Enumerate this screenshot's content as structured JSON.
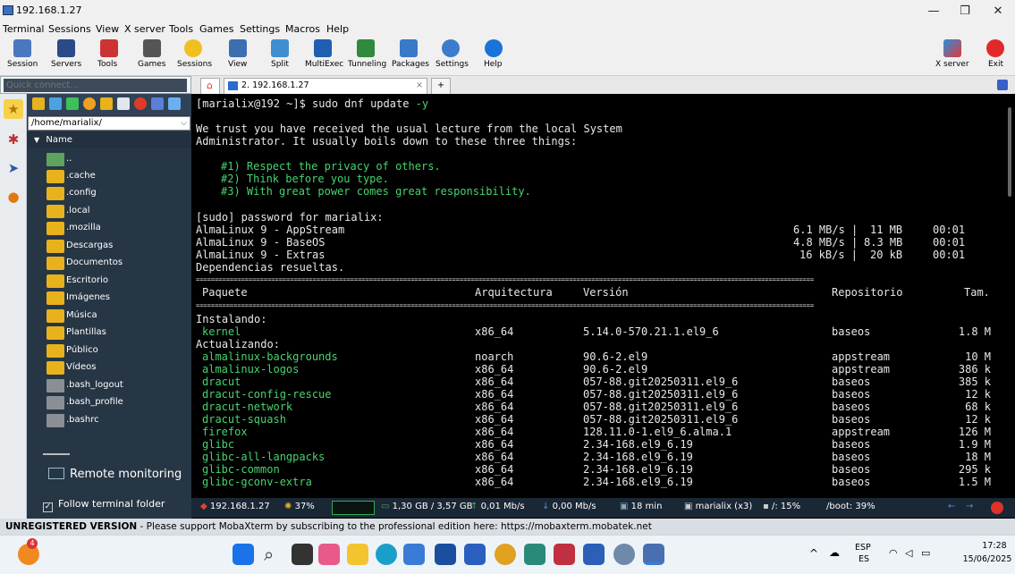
{
  "window": {
    "title": "192.168.1.27",
    "minimize": "—",
    "maximize": "❐",
    "close": "✕"
  },
  "menu": [
    "Terminal",
    "Sessions",
    "View",
    "X server",
    "Tools",
    "Games",
    "Settings",
    "Macros",
    "Help"
  ],
  "toolbar": {
    "items": [
      "Session",
      "Servers",
      "Tools",
      "Games",
      "Sessions",
      "View",
      "Split",
      "MultiExec",
      "Tunneling",
      "Packages",
      "Settings",
      "Help"
    ],
    "xserver": "X server",
    "exit": "Exit"
  },
  "quick_connect": {
    "placeholder": "Quick connect..."
  },
  "tabs": {
    "home_icon": "home-icon",
    "active": "2. 192.168.1.27",
    "close": "×",
    "add": "+"
  },
  "sidebar": {
    "path": "/home/marialix/",
    "column_header": "Name",
    "items": [
      {
        "name": "..",
        "kind": "up"
      },
      {
        "name": ".cache",
        "kind": "folder"
      },
      {
        "name": ".config",
        "kind": "folder"
      },
      {
        "name": ".local",
        "kind": "folder"
      },
      {
        "name": ".mozilla",
        "kind": "folder"
      },
      {
        "name": "Descargas",
        "kind": "folder"
      },
      {
        "name": "Documentos",
        "kind": "folder"
      },
      {
        "name": "Escritorio",
        "kind": "folder"
      },
      {
        "name": "Imágenes",
        "kind": "folder"
      },
      {
        "name": "Música",
        "kind": "folder"
      },
      {
        "name": "Plantillas",
        "kind": "folder"
      },
      {
        "name": "Público",
        "kind": "folder"
      },
      {
        "name": "Vídeos",
        "kind": "folder"
      },
      {
        "name": ".bash_logout",
        "kind": "file"
      },
      {
        "name": ".bash_profile",
        "kind": "file"
      },
      {
        "name": ".bashrc",
        "kind": "file"
      }
    ],
    "remote_monitoring": "Remote monitoring",
    "follow_terminal": "Follow terminal folder"
  },
  "terminal": {
    "prompt": "[marialix@192 ~]$ sudo dnf update ",
    "prompt_flag": "-y",
    "lecture": [
      "We trust you have received the usual lecture from the local System",
      "Administrator. It usually boils down to these three things:"
    ],
    "rules": [
      "#1) Respect the privacy of others.",
      "#2) Think before you type.",
      "#3) With great power comes great responsibility."
    ],
    "password": "[sudo] password for marialix:",
    "repos": [
      {
        "name": "AlmaLinux 9 - AppStream",
        "speed": "6.1 MB/s |",
        "size": "11 MB",
        "time": "00:01"
      },
      {
        "name": "AlmaLinux 9 - BaseOS",
        "speed": "4.8 MB/s |",
        "size": "8.3 MB",
        "time": "00:01"
      },
      {
        "name": "AlmaLinux 9 - Extras",
        "speed": "16 kB/s |",
        "size": "20 kB",
        "time": "00:01"
      }
    ],
    "resolved": "Dependencias resueltas.",
    "separator": "====================================================================================================================================================================",
    "headers": {
      "package": "Paquete",
      "arch": "Arquitectura",
      "version": "Versión",
      "repo": "Repositorio",
      "size": "Tam."
    },
    "installing": "Instalando:",
    "install_rows": [
      {
        "pkg": "kernel",
        "arch": "x86_64",
        "ver": "5.14.0-570.21.1.el9_6",
        "repo": "baseos",
        "size": "1.8 M"
      }
    ],
    "updating": "Actualizando:",
    "update_rows": [
      {
        "pkg": "almalinux-backgrounds",
        "arch": "noarch",
        "ver": "90.6-2.el9",
        "repo": "appstream",
        "size": "10 M"
      },
      {
        "pkg": "almalinux-logos",
        "arch": "x86_64",
        "ver": "90.6-2.el9",
        "repo": "appstream",
        "size": "386 k"
      },
      {
        "pkg": "dracut",
        "arch": "x86_64",
        "ver": "057-88.git20250311.el9_6",
        "repo": "baseos",
        "size": "385 k"
      },
      {
        "pkg": "dracut-config-rescue",
        "arch": "x86_64",
        "ver": "057-88.git20250311.el9_6",
        "repo": "baseos",
        "size": "12 k"
      },
      {
        "pkg": "dracut-network",
        "arch": "x86_64",
        "ver": "057-88.git20250311.el9_6",
        "repo": "baseos",
        "size": "68 k"
      },
      {
        "pkg": "dracut-squash",
        "arch": "x86_64",
        "ver": "057-88.git20250311.el9_6",
        "repo": "baseos",
        "size": "12 k"
      },
      {
        "pkg": "firefox",
        "arch": "x86_64",
        "ver": "128.11.0-1.el9_6.alma.1",
        "repo": "appstream",
        "size": "126 M"
      },
      {
        "pkg": "glibc",
        "arch": "x86_64",
        "ver": "2.34-168.el9_6.19",
        "repo": "baseos",
        "size": "1.9 M"
      },
      {
        "pkg": "glibc-all-langpacks",
        "arch": "x86_64",
        "ver": "2.34-168.el9_6.19",
        "repo": "baseos",
        "size": "18 M"
      },
      {
        "pkg": "glibc-common",
        "arch": "x86_64",
        "ver": "2.34-168.el9_6.19",
        "repo": "baseos",
        "size": "295 k"
      },
      {
        "pkg": "glibc-gconv-extra",
        "arch": "x86_64",
        "ver": "2.34-168.el9_6.19",
        "repo": "baseos",
        "size": "1.5 M"
      }
    ]
  },
  "status": {
    "host": "192.168.1.27",
    "cpu": "37%",
    "memory": "1,30 GB / 3,57 GB",
    "upload": "0,01 Mb/s",
    "download": "0,00 Mb/s",
    "uptime": "18 min",
    "users": "marialix (x3)",
    "disk_root": "/: 15%",
    "disk_boot": "/boot: 39%"
  },
  "banner": {
    "bold": "UNREGISTERED VERSION",
    "text": "  -  Please support MobaXterm by subscribing to the professional edition here:  ",
    "link": "https://mobaxterm.mobatek.net"
  },
  "taskbar": {
    "lang": "ESP",
    "lang2": "ES",
    "time": "17:28",
    "date": "15/06/2025",
    "badge": "4"
  },
  "colors": {
    "accent": "#3a7bd5",
    "terminal_green": "#46d46e",
    "folder": "#e8b21c",
    "sidebar_bg": "#273645"
  }
}
